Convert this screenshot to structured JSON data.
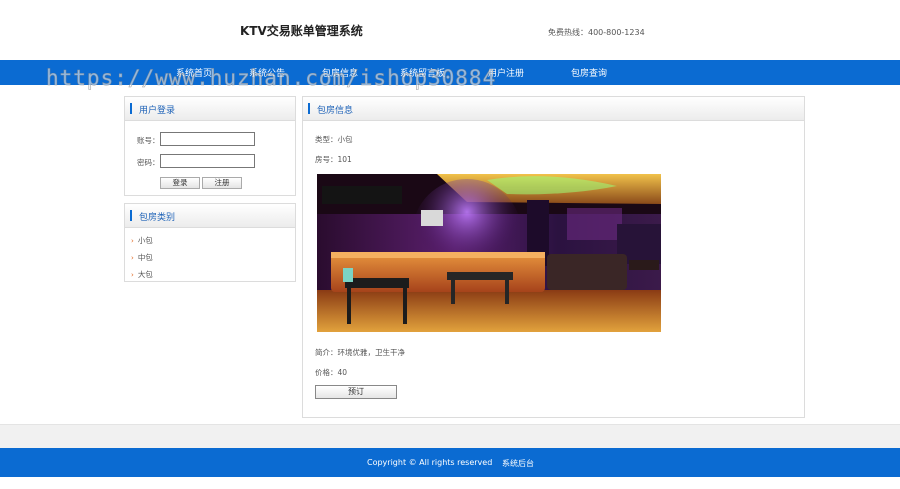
{
  "header": {
    "title": "KTV交易账单管理系统",
    "hotline": "免费热线：400-800-1234"
  },
  "nav": {
    "items": [
      "系统首页",
      "系统公告",
      "包房信息",
      "系统留言板",
      "用户注册",
      "包房查询"
    ]
  },
  "watermark": "https://www.huzhan.com/ishop30884",
  "login": {
    "title": "用户登录",
    "account_label": "账号：",
    "account_value": "",
    "password_label": "密码：",
    "password_value": "",
    "login_button": "登录",
    "register_button": "注册"
  },
  "categories": {
    "title": "包房类别",
    "items": [
      "小包",
      "中包",
      "大包"
    ]
  },
  "room": {
    "title": "包房信息",
    "type": "类型：小包",
    "number": "房号：101",
    "photo_icon": "ktv-room-photo",
    "intro": "简介：环境优雅，卫生干净",
    "price": "价格：40",
    "book_button": "预订"
  },
  "footer": {
    "copyright": "Copyright © All rights reserved",
    "admin_link": "系统后台"
  },
  "colors": {
    "primary_blue": "#0b6bd2",
    "title_blue": "#1f63b8",
    "arrow_orange": "#e0641b"
  }
}
